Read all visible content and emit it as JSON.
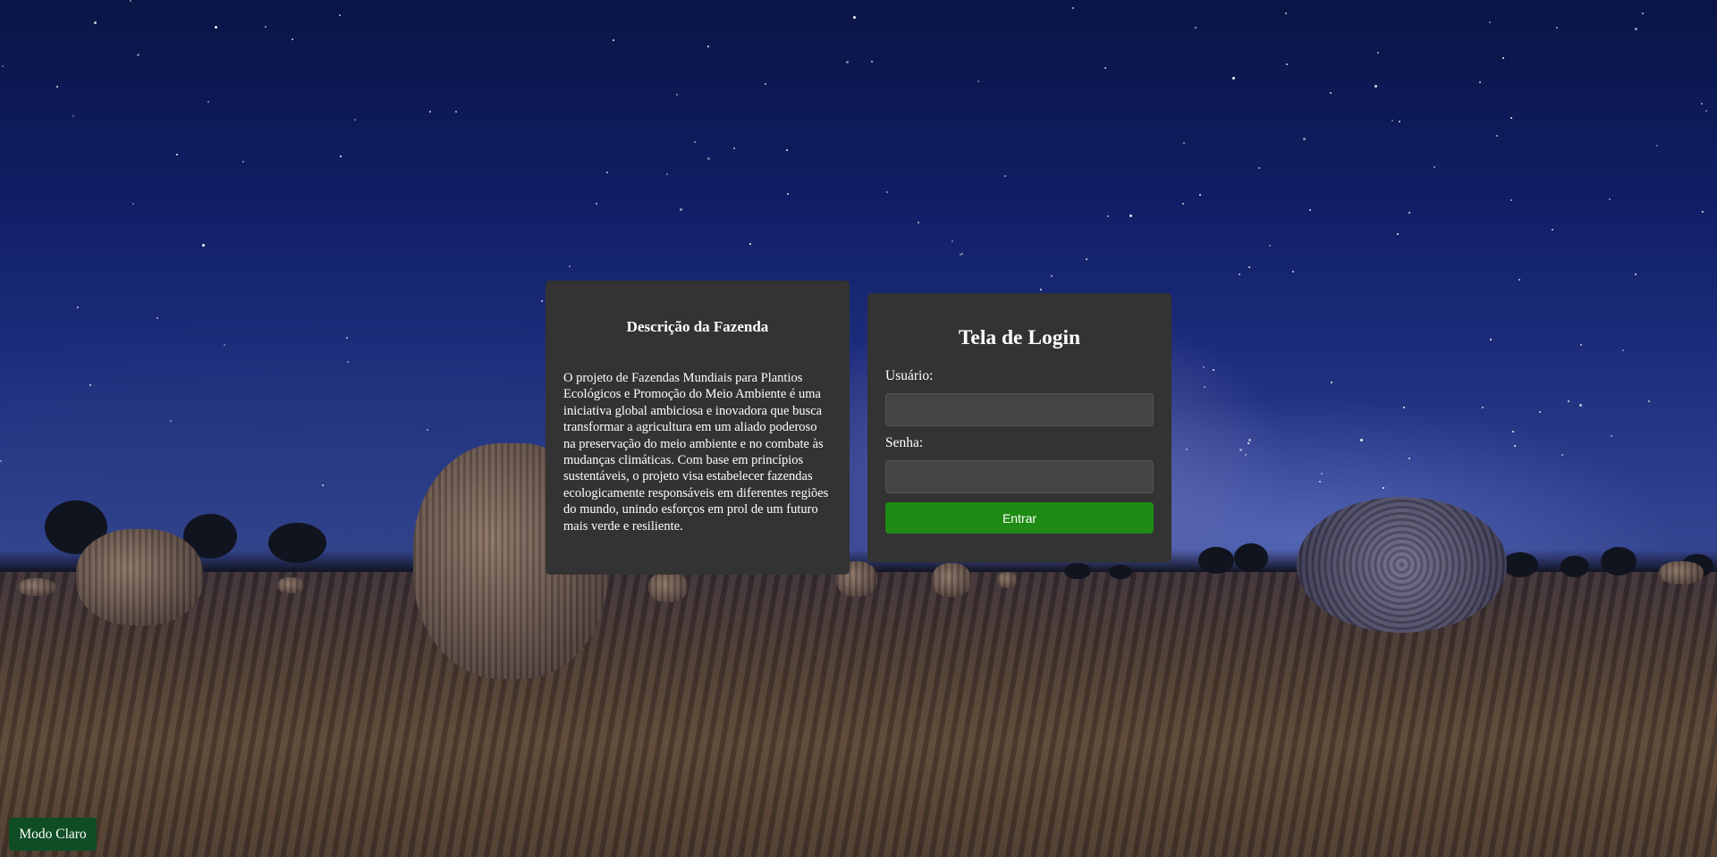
{
  "description": {
    "title": "Descrição da Fazenda",
    "text": "O projeto de Fazendas Mundiais para Plantios Ecológicos e Promoção do Meio Ambiente é uma iniciativa global ambiciosa e inovadora que busca transformar a agricultura em um aliado poderoso na preservação do meio ambiente e no combate às mudanças climáticas. Com base em princípios sustentáveis, o projeto visa estabelecer fazendas ecologicamente responsáveis em diferentes regiões do mundo, unindo esforços em prol de um futuro mais verde e resiliente."
  },
  "login": {
    "title": "Tela de Login",
    "username_label": "Usuário:",
    "username_value": "",
    "password_label": "Senha:",
    "password_value": "",
    "submit_label": "Entrar"
  },
  "theme_toggle": {
    "label": "Modo Claro"
  },
  "colors": {
    "panel_bg": "#333333",
    "input_bg": "#444444",
    "submit_bg": "#1e8c14",
    "toggle_bg": "#0f4d24"
  }
}
